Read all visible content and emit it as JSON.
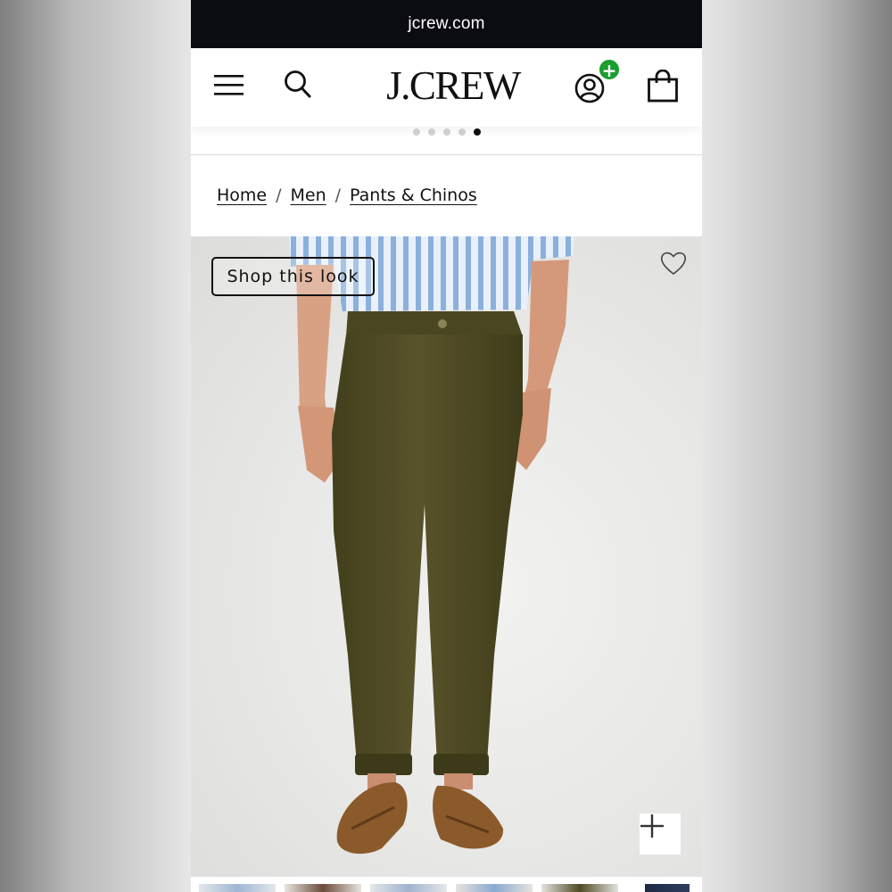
{
  "browser": {
    "url": "jcrew.com"
  },
  "header": {
    "logo": "J.CREW",
    "menu_icon": "hamburger-menu-icon",
    "search_icon": "search-icon",
    "account_icon": "account-icon",
    "account_badge": "+",
    "bag_icon": "shopping-bag-icon",
    "badge_color": "#1a9e2e"
  },
  "carousel": {
    "total_dots": 5,
    "active_index": 4
  },
  "breadcrumb": {
    "items": [
      {
        "label": "Home"
      },
      {
        "label": "Men"
      },
      {
        "label": "Pants & Chinos"
      }
    ],
    "separator": "/"
  },
  "product_image": {
    "shop_the_look": "Shop this look",
    "wishlist_icon": "heart-icon",
    "zoom_icon": "plus-icon"
  },
  "colors": {
    "chino": "#4e4a23",
    "shirt_stripe": "#8bb0dc",
    "loafer": "#8b5a2b",
    "topbar": "#0b0b12"
  }
}
